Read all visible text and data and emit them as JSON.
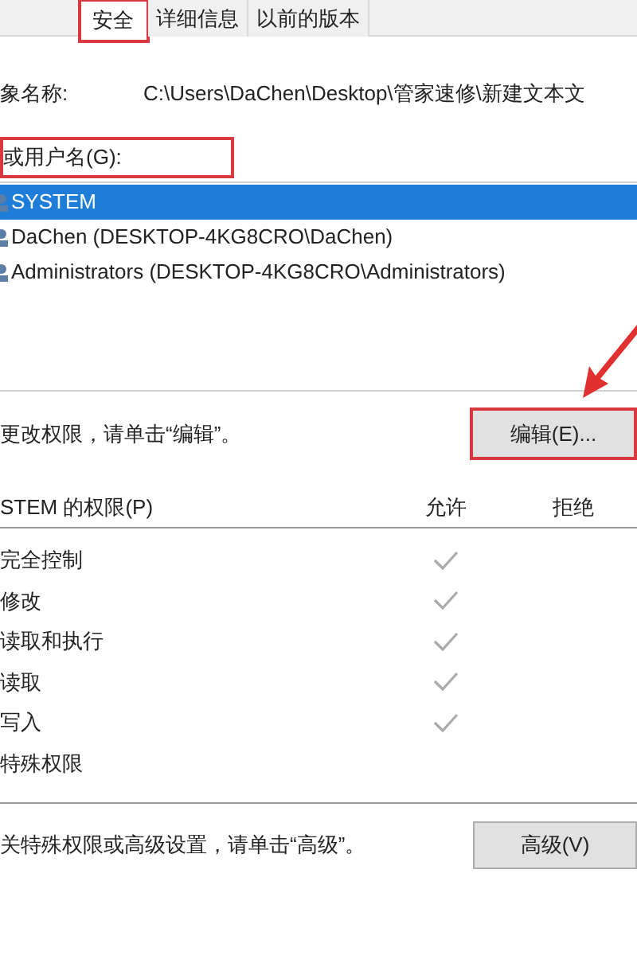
{
  "tabs": [
    {
      "label": "安全",
      "selected": true,
      "highlighted": true
    },
    {
      "label": "详细信息",
      "selected": false,
      "highlighted": false
    },
    {
      "label": "以前的版本",
      "selected": false,
      "highlighted": false
    }
  ],
  "object_name": {
    "label": "象名称:",
    "value": "C:\\Users\\DaChen\\Desktop\\管家速修\\新建文本文"
  },
  "users_label": "或用户名(G):",
  "users": [
    {
      "name": "SYSTEM",
      "selected": true
    },
    {
      "name": "DaChen (DESKTOP-4KG8CRO\\DaChen)",
      "selected": false
    },
    {
      "name": "Administrators (DESKTOP-4KG8CRO\\Administrators)",
      "selected": false
    }
  ],
  "edit_hint": "更改权限，请单击“编辑”。",
  "edit_button": "编辑(E)...",
  "permissions": {
    "title": "STEM 的权限(P)",
    "allow_header": "允许",
    "deny_header": "拒绝",
    "rows": [
      {
        "name": "完全控制",
        "allow": true,
        "deny": false
      },
      {
        "name": "修改",
        "allow": true,
        "deny": false
      },
      {
        "name": "读取和执行",
        "allow": true,
        "deny": false
      },
      {
        "name": "读取",
        "allow": true,
        "deny": false
      },
      {
        "name": "写入",
        "allow": true,
        "deny": false
      },
      {
        "name": "特殊权限",
        "allow": false,
        "deny": false
      }
    ]
  },
  "advanced_hint": "关特殊权限或高级设置，请单击“高级”。",
  "advanced_button": "高级(V)"
}
